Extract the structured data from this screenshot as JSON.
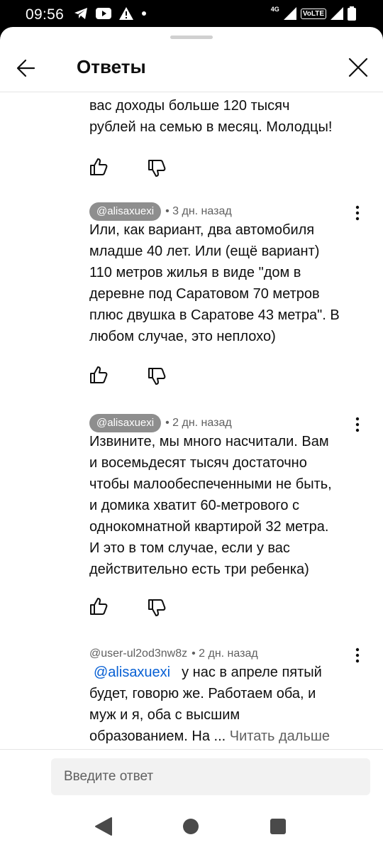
{
  "status_bar": {
    "time": "09:56",
    "network": "4G",
    "volte": "VoLTE"
  },
  "header": {
    "title": "Ответы"
  },
  "previous_comment": {
    "partial_lines": [
      "вас доходы больше 120 тысяч",
      "рублей на семью в месяц. Молодцы!"
    ]
  },
  "comments": [
    {
      "author": "@alisaxuexi",
      "date": "• 3 дн. назад",
      "lines": [
        "Или, как вариант, два автомобиля",
        "младше 40 лет. Или (ещё вариант)",
        "110 метров жилья в виде \"дом в",
        "деревне под Саратовом 70 метров",
        "плюс двушка в Саратове 43 метра\". В",
        "любом случае, это неплохо)"
      ]
    },
    {
      "author": "@alisaxuexi",
      "date": "• 2 дн. назад",
      "lines": [
        "Извините, мы много насчитали. Вам",
        "и восемьдесят тысяч достаточно",
        "чтобы малообеспеченными не быть,",
        "и домика хватит 60-метрового с",
        "однокомнатной квартирой 32 метра.",
        "И это в том случае, если у вас",
        "действительно есть три ребенка)"
      ]
    },
    {
      "author": "@user-ul2od3nw8z",
      "date": "• 2 дн. назад",
      "mention": "@alisaxuexi",
      "first_line_rest": "у нас в апреле пятый",
      "lines": [
        "будет, говорю же. Работаем оба, и",
        "муж и я, оба с высшим"
      ],
      "last_line": "образованием. На ...",
      "read_more": "Читать дальше"
    }
  ],
  "composer": {
    "placeholder": "Введите ответ"
  },
  "icons": {
    "back": "arrow-left-icon",
    "close": "close-icon",
    "like": "thumb-up-icon",
    "dislike": "thumb-down-icon",
    "more": "more-vertical-icon"
  }
}
